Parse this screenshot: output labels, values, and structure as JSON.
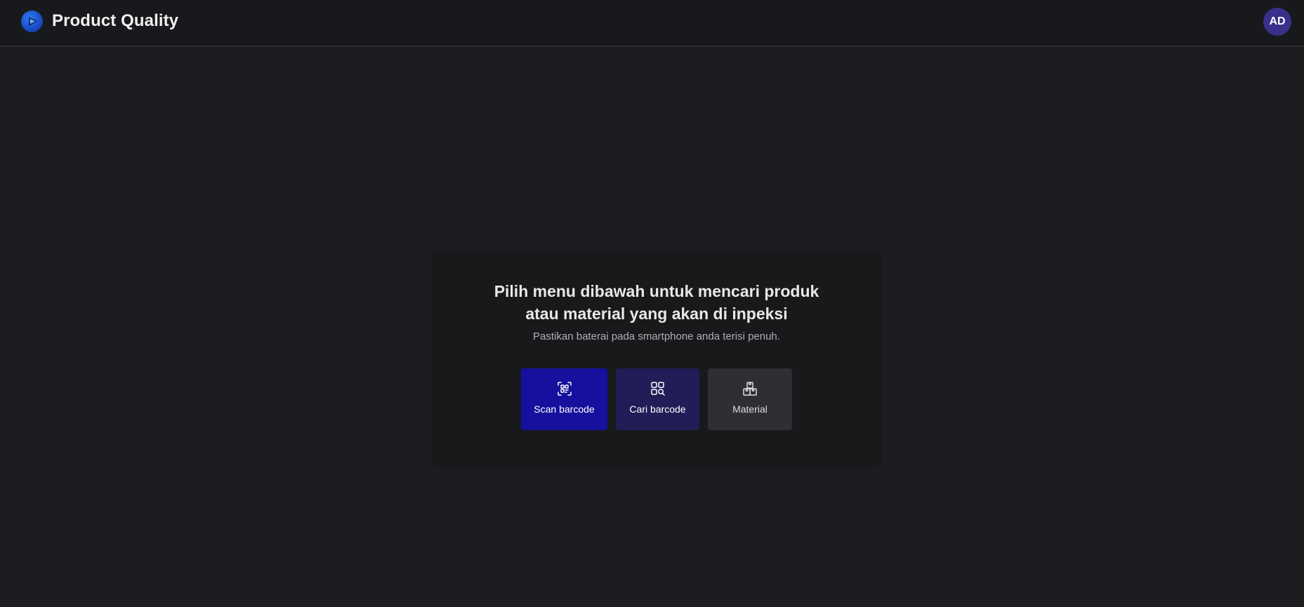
{
  "header": {
    "app_title": "Product Quality",
    "logo_icon": "play-circle-logo-icon",
    "user_initials": "AD"
  },
  "main": {
    "title": "Pilih menu dibawah untuk mencari produk atau material yang akan di inpeksi",
    "subtitle": "Pastikan baterai pada smartphone anda terisi penuh.",
    "buttons": [
      {
        "label": "Scan barcode",
        "icon": "scan-barcode-icon",
        "color": "#15119e"
      },
      {
        "label": "Cari barcode",
        "icon": "search-barcode-icon",
        "color": "#211d57"
      },
      {
        "label": "Material",
        "icon": "boxes-icon",
        "color": "#2d2f33"
      }
    ]
  },
  "colors": {
    "background": "#1c1d20",
    "header_background": "#18191c",
    "card_background": "#18191b",
    "avatar_background": "#3a2f8a"
  }
}
